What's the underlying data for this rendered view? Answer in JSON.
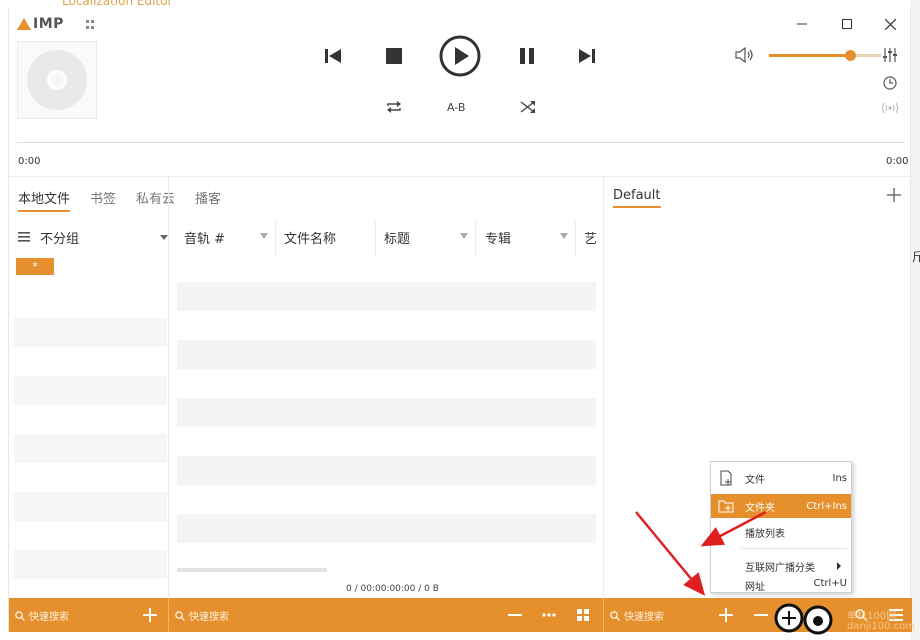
{
  "background": {
    "title_fragment": "Localization Editor",
    "edge_text": "斤"
  },
  "app": {
    "logo_text": "IMP"
  },
  "playback": {
    "ab_label": "A-B",
    "time_start": "0:00",
    "time_end": "0:00",
    "volume_percent": 72
  },
  "tabs": [
    "本地文件",
    "书签",
    "私有云",
    "播客"
  ],
  "playlist": {
    "tab": "Default"
  },
  "group": {
    "label": "不分组",
    "all_chip": "*"
  },
  "table": {
    "columns": [
      "音轨 #",
      "文件名称",
      "标题",
      "专辑",
      "艺"
    ],
    "totals": "0 / 00:00:00:00 / 0 B"
  },
  "bottom": {
    "search_left": "快速搜索",
    "search_mid": "快速搜索",
    "search_right": "快速搜索",
    "watermark": "单机100网 danji100.com"
  },
  "menu": {
    "items": [
      {
        "label": "文件",
        "shortcut": "Ins"
      },
      {
        "label": "文件夹",
        "shortcut": "Ctrl+Ins"
      },
      {
        "label": "播放列表",
        "shortcut": ""
      },
      {
        "label": "互联网广播分类",
        "shortcut": ""
      },
      {
        "label": "网址",
        "shortcut": "Ctrl+U"
      }
    ]
  },
  "colors": {
    "accent": "#e5902c",
    "annotation": "#e02020"
  }
}
